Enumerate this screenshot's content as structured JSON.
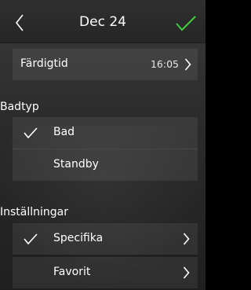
{
  "header": {
    "title": "Dec 24",
    "back_icon": "chevron-left-icon",
    "confirm_icon": "checkmark-icon",
    "confirm_color": "#3fcf3f"
  },
  "ready_time": {
    "label": "Färdigtid",
    "value": "16:05"
  },
  "bath_type": {
    "heading": "Badtyp",
    "options": [
      {
        "label": "Bad",
        "selected": true
      },
      {
        "label": "Standby",
        "selected": false
      }
    ]
  },
  "settings": {
    "heading": "Inställningar",
    "items": [
      {
        "label": "Specifika",
        "selected": true
      },
      {
        "label": "Favorit",
        "selected": false
      }
    ]
  }
}
